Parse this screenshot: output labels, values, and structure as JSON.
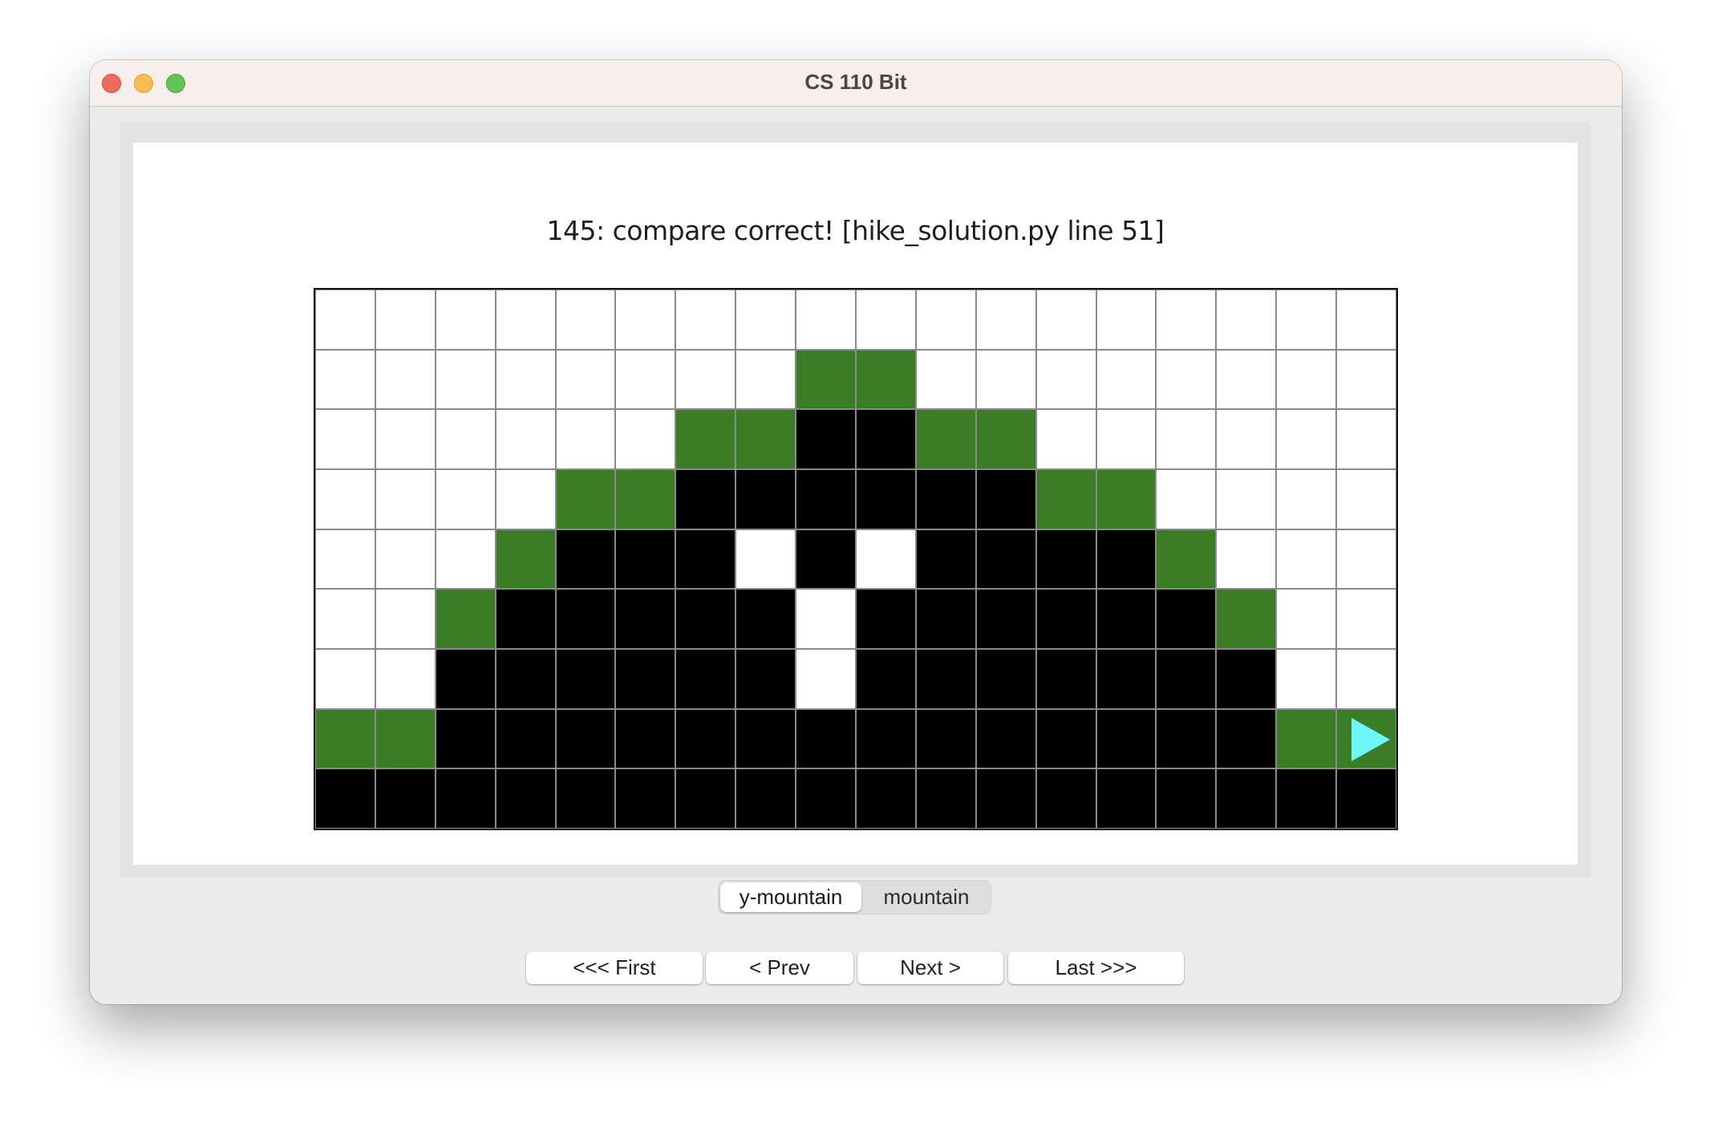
{
  "window": {
    "title": "CS 110 Bit",
    "controls": [
      "close",
      "minimize",
      "maximize"
    ]
  },
  "status_line": "145: compare correct!  [hike_solution.py line 51]",
  "world": {
    "columns": 18,
    "rows": 9,
    "colors": {
      "white": "#ffffff",
      "black": "#000000",
      "green": "#3a7d24",
      "bit": "#6ff6fb",
      "grid_line": "#8a8a8a"
    },
    "cells": [
      "wwwwwwwwwwwwwwwwww",
      "wwwwwwwwggwwwwwwww",
      "wwwwwwggbbggwwwwww",
      "wwwwggbbbbbbggwwww",
      "wwwgbbbwbwbbbbgwww",
      "wwgbbbbbwbbbbbbgww",
      "wwbbbbbbwbbbbbbbww",
      "ggbbbbbbbbbbbbbbgg",
      "bbbbbbbbbbbbbbbbbb"
    ],
    "bit": {
      "row": 7,
      "col": 17,
      "direction": "right",
      "icon": "bit-arrow-right-icon"
    }
  },
  "tabs": [
    {
      "label": "y-mountain",
      "selected": true
    },
    {
      "label": "mountain",
      "selected": false
    }
  ],
  "navigation": {
    "first": "<<< First",
    "prev": "< Prev",
    "next": "Next >",
    "last": "Last >>>"
  }
}
